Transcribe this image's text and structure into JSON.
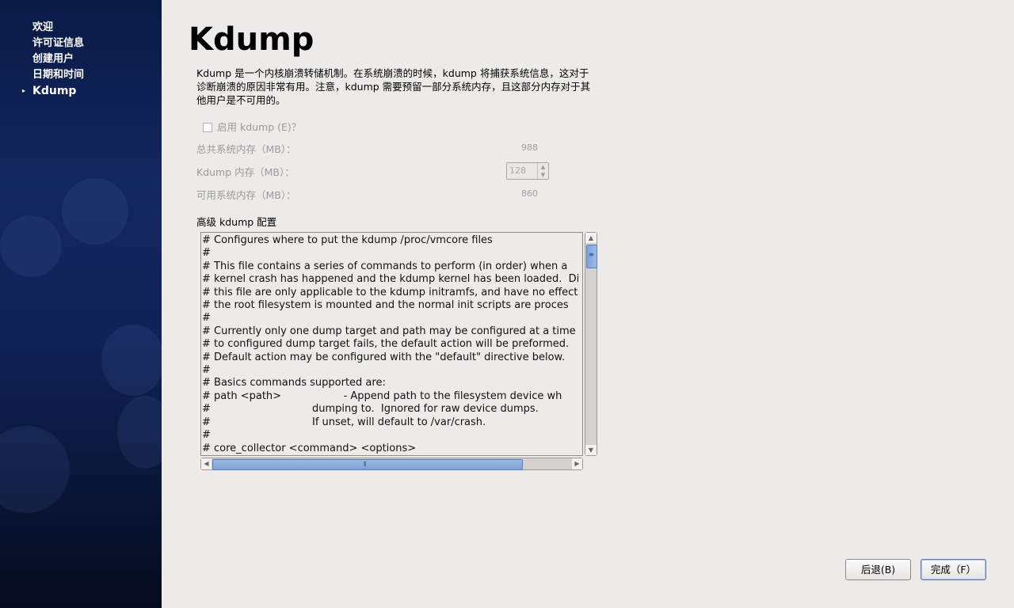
{
  "sidebar": {
    "items": [
      {
        "label": "欢迎",
        "active": false
      },
      {
        "label": "许可证信息",
        "active": false
      },
      {
        "label": "创建用户",
        "active": false
      },
      {
        "label": "日期和时间",
        "active": false
      },
      {
        "label": "Kdump",
        "active": true
      }
    ]
  },
  "main": {
    "title": "Kdump",
    "description": "Kdump 是一个内核崩溃转储机制。在系统崩溃的时候，kdump 将捕获系统信息，这对于诊断崩溃的原因非常有用。注意，kdump 需要预留一部分系统内存，且这部分内存对于其他用户是不可用的。",
    "enable_label": "启用 kdump (E)？",
    "enable_checked": false,
    "total_memory_label": "总共系统内存（MB）：",
    "total_memory_value": "988",
    "kdump_memory_label": "Kdump 内存（MB）：",
    "kdump_memory_value": "128",
    "usable_memory_label": "可用系统内存（MB）：",
    "usable_memory_value": "860",
    "advanced_label": "高级 kdump 配置",
    "config_text": "# Configures where to put the kdump /proc/vmcore files\n#\n# This file contains a series of commands to perform (in order) when a\n# kernel crash has happened and the kdump kernel has been loaded.  Di\n# this file are only applicable to the kdump initramfs, and have no effect\n# the root filesystem is mounted and the normal init scripts are proces\n#\n# Currently only one dump target and path may be configured at a time\n# to configured dump target fails, the default action will be preformed.\n# Default action may be configured with the \"default\" directive below.\n#\n# Basics commands supported are:\n# path <path>                   - Append path to the filesystem device wh\n#                               dumping to.  Ignored for raw device dumps.\n#                               If unset, will default to /var/crash.\n#\n# core_collector <command> <options>"
  },
  "buttons": {
    "back": "后退(B)",
    "finish": "完成（F）"
  }
}
